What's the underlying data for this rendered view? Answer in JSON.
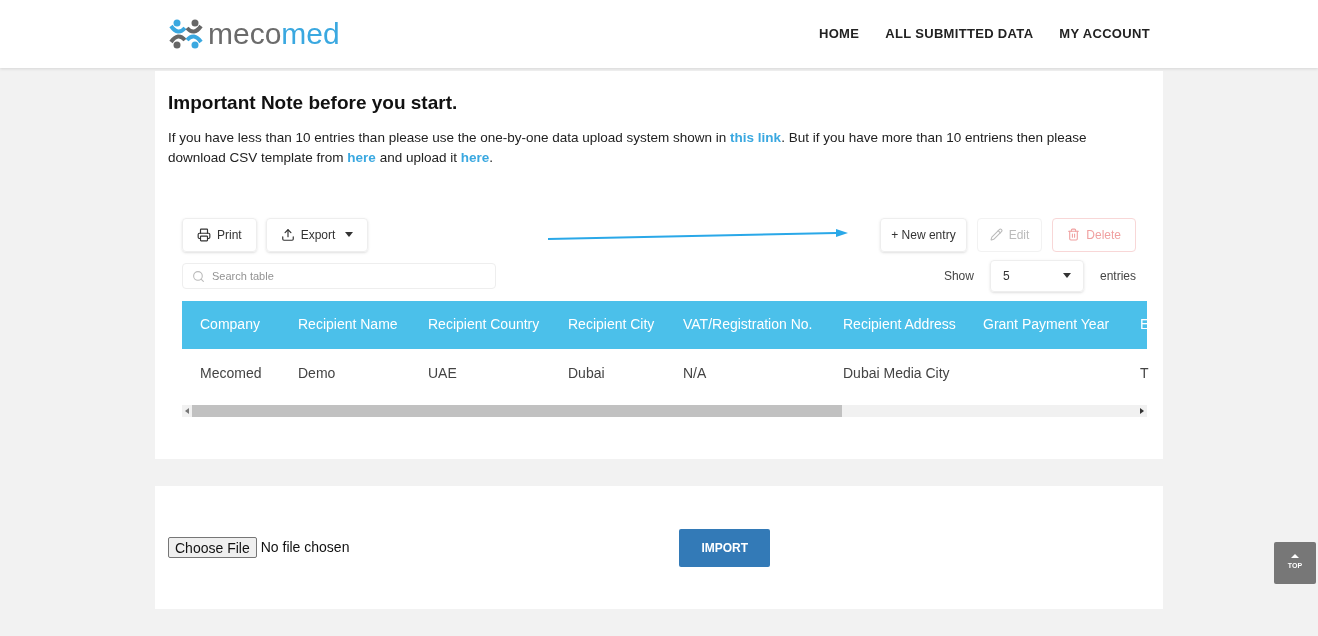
{
  "header": {
    "logo": {
      "part_a": "meco",
      "part_b": "med"
    },
    "nav": [
      {
        "label": "HOME"
      },
      {
        "label": "ALL SUBMITTED DATA"
      },
      {
        "label": "MY ACCOUNT"
      }
    ]
  },
  "note": {
    "title": "Important Note before you start.",
    "segments": [
      {
        "kind": "text",
        "text": "If you have less than 10 entries than please use the one-by-one data upload system shown in "
      },
      {
        "kind": "link",
        "text": "this link"
      },
      {
        "kind": "text",
        "text": ". But if you have more than 10 entriens then please download CSV template from "
      },
      {
        "kind": "link",
        "text": "here"
      },
      {
        "kind": "text",
        "text": " and upload it "
      },
      {
        "kind": "link",
        "text": "here"
      },
      {
        "kind": "text",
        "text": "."
      }
    ]
  },
  "toolbar": {
    "print": "Print",
    "export": "Export",
    "new_entry": "+ New entry",
    "edit": {
      "label": "Edit",
      "disabled": true
    },
    "delete": {
      "label": "Delete",
      "disabled": true
    },
    "search": {
      "placeholder": "Search table"
    },
    "show_label": "Show",
    "page_size": "5",
    "entries_label": "entries"
  },
  "table": {
    "columns": [
      "Company",
      "Recipient Name",
      "Recipient Country",
      "Recipient City",
      "VAT/Registration No.",
      "Recipient Address",
      "Grant Payment Year",
      "E"
    ],
    "rows": [
      [
        "Mecomed",
        "Demo",
        "UAE",
        "Dubai",
        "N/A",
        "Dubai Media City",
        "",
        "T"
      ]
    ]
  },
  "import": {
    "choose_file": "Choose File",
    "file_status": "No file chosen",
    "button": "IMPORT"
  },
  "top_button": "TOP"
}
